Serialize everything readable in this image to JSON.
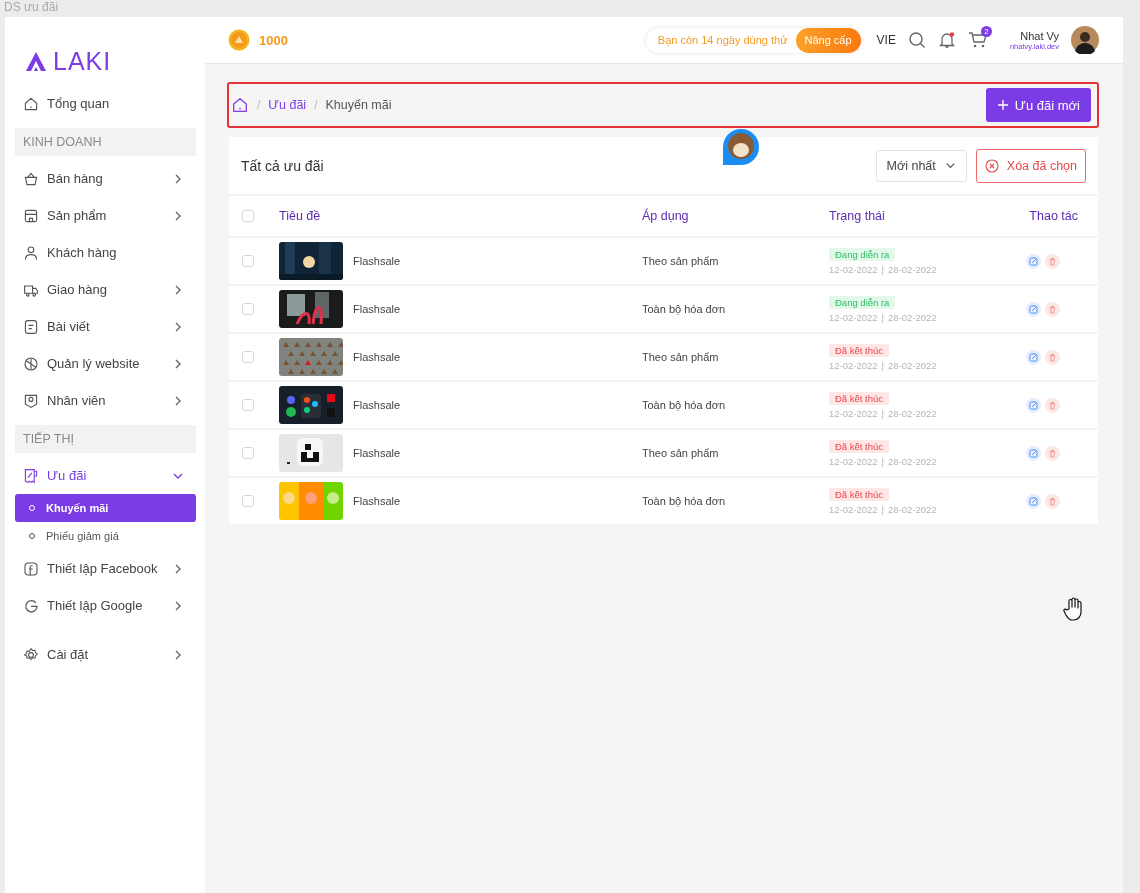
{
  "frame_title": "DS ưu đãi",
  "brand": {
    "name": "LAKI"
  },
  "sidebar": {
    "items": [
      {
        "kind": "item",
        "label": "Tổng quan",
        "chevron": false
      },
      {
        "kind": "section",
        "label": "KINH DOANH"
      },
      {
        "kind": "item",
        "label": "Bán hàng",
        "chevron": true
      },
      {
        "kind": "item",
        "label": "Sản phẩm",
        "chevron": true
      },
      {
        "kind": "item",
        "label": "Khách hàng",
        "chevron": false
      },
      {
        "kind": "item",
        "label": "Giao hàng",
        "chevron": true
      },
      {
        "kind": "item",
        "label": "Bài viết",
        "chevron": true
      },
      {
        "kind": "item",
        "label": "Quản lý website",
        "chevron": true
      },
      {
        "kind": "item",
        "label": "Nhân viên",
        "chevron": true
      },
      {
        "kind": "section",
        "label": "TIẾP THỊ"
      },
      {
        "kind": "group",
        "label": "Ưu đãi",
        "expanded": true,
        "children": [
          {
            "label": "Khuyến mãi",
            "selected": true
          },
          {
            "label": "Phiếu giảm giá",
            "selected": false
          }
        ]
      },
      {
        "kind": "item",
        "label": "Thiết lập Facebook",
        "chevron": true
      },
      {
        "kind": "item",
        "label": "Thiết lập Google",
        "chevron": true
      },
      {
        "kind": "gap"
      },
      {
        "kind": "item",
        "label": "Cài đặt",
        "chevron": true
      }
    ]
  },
  "topbar": {
    "coins": "1000",
    "trial": "Bạn còn 14 ngày dùng thử",
    "upgrade": "Nâng cấp",
    "language": "VIE",
    "cart_count": "2",
    "notification_dot": true,
    "user_name": "Nhat Vy",
    "user_site": "nhatvy.laki.dev"
  },
  "breadcrumb": {
    "items": [
      {
        "separator": "/",
        "label": "Ưu đãi"
      },
      {
        "separator": "/",
        "label": "Khuyến mãi"
      }
    ],
    "new_button": "Ưu đãi mới"
  },
  "card": {
    "title": "Tất cả ưu đãi",
    "sort": "Mới nhất",
    "delete_button": "Xóa đã chọn"
  },
  "table": {
    "select_all_checked": false,
    "columns": [
      "Tiêu đề",
      "Áp dụng",
      "Trạng thái",
      "Thao tác"
    ],
    "rows": [
      {
        "checked": false,
        "title": "Flashsale",
        "apply": "Theo sản phẩm",
        "status": "Đang diễn ra",
        "ended": false,
        "start": "12-02-2022",
        "date_separator": "|",
        "end": "28-02-2022"
      },
      {
        "checked": false,
        "title": "Flashsale",
        "apply": "Toàn bộ hóa đơn",
        "status": "Đang diễn ra",
        "ended": false,
        "start": "12-02-2022",
        "date_separator": "|",
        "end": "28-02-2022"
      },
      {
        "checked": false,
        "title": "Flashsale",
        "apply": "Theo sản phẩm",
        "status": "Đã kết thúc",
        "ended": true,
        "start": "12-02-2022",
        "date_separator": "|",
        "end": "28-02-2022"
      },
      {
        "checked": false,
        "title": "Flashsale",
        "apply": "Toàn bộ hóa đơn",
        "status": "Đã kết thúc",
        "ended": true,
        "start": "12-02-2022",
        "date_separator": "|",
        "end": "28-02-2022"
      },
      {
        "checked": false,
        "title": "Flashsale",
        "apply": "Theo sản phẩm",
        "status": "Đã kết thúc",
        "ended": true,
        "start": "12-02-2022",
        "date_separator": "|",
        "end": "28-02-2022"
      },
      {
        "checked": false,
        "title": "Flashsale",
        "apply": "Toàn bộ hóa đơn",
        "status": "Đã kết thúc",
        "ended": true,
        "start": "12-02-2022",
        "date_separator": "|",
        "end": "28-02-2022"
      }
    ]
  }
}
